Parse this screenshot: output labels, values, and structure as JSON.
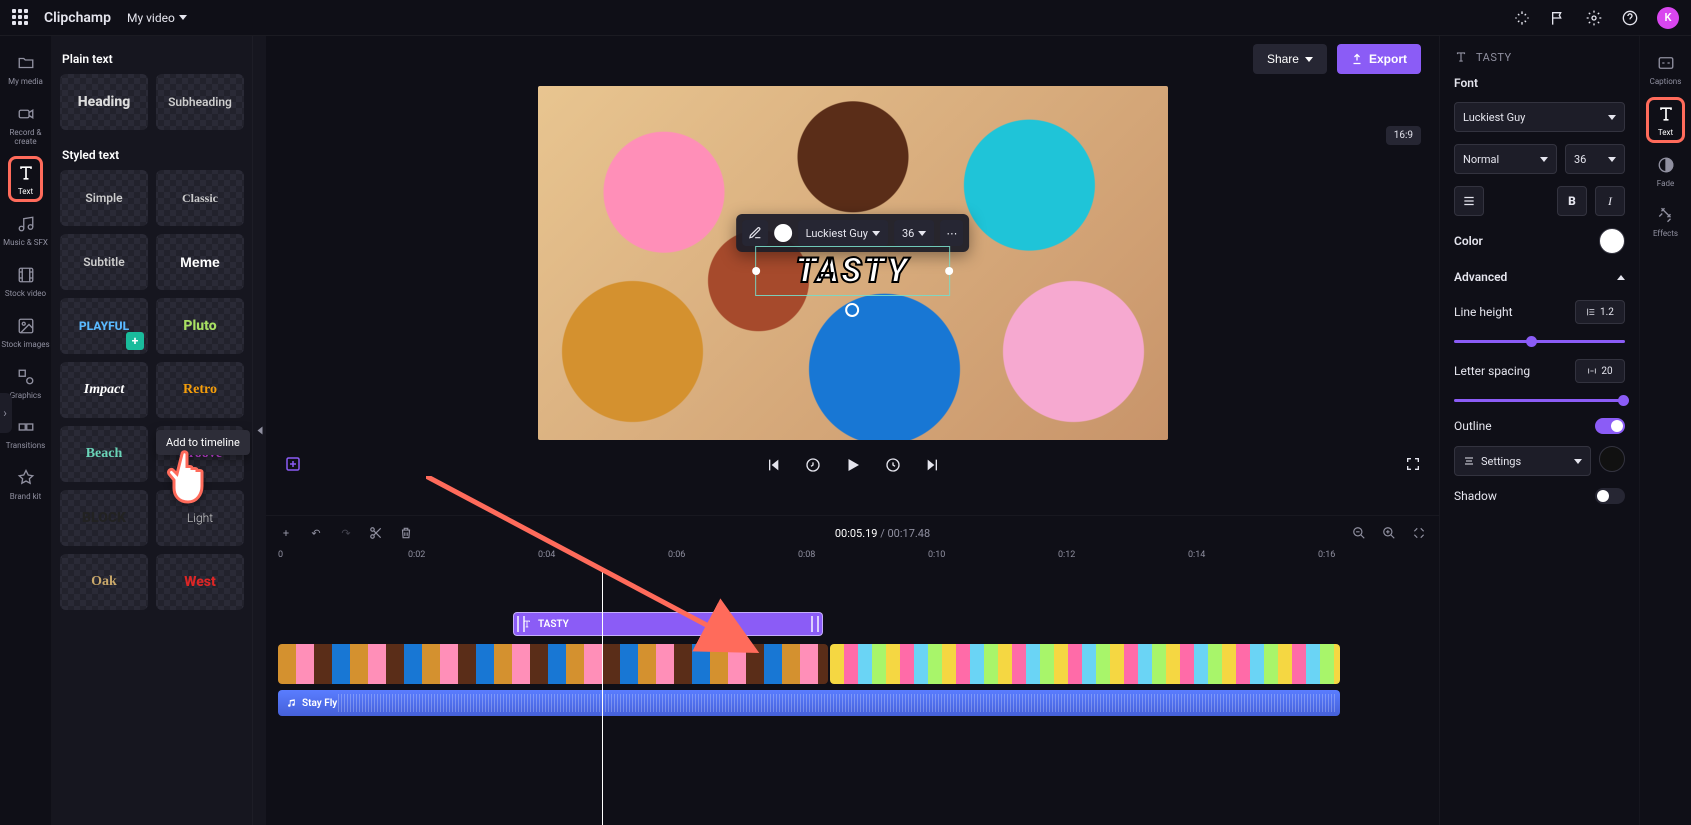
{
  "app": {
    "brand": "Clipchamp",
    "video_title": "My video"
  },
  "top_actions": {
    "share": "Share",
    "export": "Export",
    "avatar_initial": "K"
  },
  "left_rail": [
    {
      "id": "my-media",
      "label": "My media"
    },
    {
      "id": "record-create",
      "label": "Record & create"
    },
    {
      "id": "text",
      "label": "Text"
    },
    {
      "id": "music-sfx",
      "label": "Music & SFX"
    },
    {
      "id": "stock-video",
      "label": "Stock video"
    },
    {
      "id": "stock-images",
      "label": "Stock images"
    },
    {
      "id": "graphics",
      "label": "Graphics"
    },
    {
      "id": "transitions",
      "label": "Transitions"
    },
    {
      "id": "brand-kit",
      "label": "Brand kit"
    }
  ],
  "right_rail": [
    {
      "id": "captions",
      "label": "Captions"
    },
    {
      "id": "text",
      "label": "Text"
    },
    {
      "id": "fade",
      "label": "Fade"
    },
    {
      "id": "effects",
      "label": "Effects"
    }
  ],
  "panel": {
    "section_plain": "Plain text",
    "section_styled": "Styled text",
    "plain": [
      "Heading",
      "Subheading"
    ],
    "styled": [
      "Simple",
      "Classic",
      "Subtitle",
      "Meme",
      "PLAYFUL",
      "Pluto",
      "Impact",
      "Retro",
      "Beach",
      "Groove",
      "BLOCK",
      "Light",
      "Oak",
      "West"
    ],
    "tooltip": "Add to timeline"
  },
  "preview": {
    "aspect": "16:9",
    "text_value": "TASTY",
    "toolbar": {
      "font": "Luckiest Guy",
      "size": "36"
    }
  },
  "timeline": {
    "current": "00:05.19",
    "total": "00:17.48",
    "ticks": [
      "0",
      "0:02",
      "0:04",
      "0:06",
      "0:08",
      "0:10",
      "0:12",
      "0:14",
      "0:16"
    ],
    "text_clip": "TASTY",
    "audio_clip": "Stay Fly"
  },
  "props": {
    "header": "TASTY",
    "font_label": "Font",
    "font_value": "Luckiest Guy",
    "weight_value": "Normal",
    "size_value": "36",
    "color_label": "Color",
    "advanced_label": "Advanced",
    "line_height_label": "Line height",
    "line_height_value": "1.2",
    "letter_spacing_label": "Letter spacing",
    "letter_spacing_value": "20",
    "outline_label": "Outline",
    "settings_label": "Settings",
    "shadow_label": "Shadow"
  }
}
